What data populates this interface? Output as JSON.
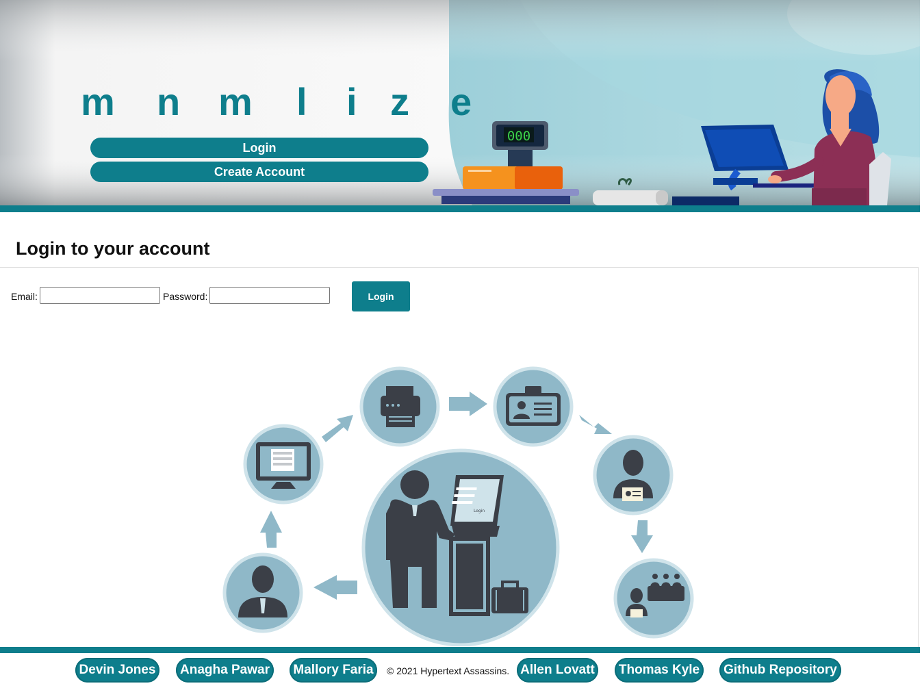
{
  "brand": {
    "letters": [
      "m",
      "n",
      "m",
      "l",
      "i",
      "z",
      "e"
    ]
  },
  "hero": {
    "login_label": "Login",
    "create_account_label": "Create Account",
    "scale_display": "000"
  },
  "login": {
    "heading": "Login to your account",
    "email_label": "Email:",
    "email_value": "",
    "password_label": "Password:",
    "password_value": "",
    "submit_label": "Login"
  },
  "diagram": {
    "screen_label": "Login"
  },
  "footer": {
    "links": [
      "Devin Jones",
      "Anagha Pawar",
      "Mallory Faria",
      "Allen Lovatt",
      "Thomas Kyle",
      "Github Repository"
    ],
    "copyright": "© 2021 Hypertext Assassins."
  },
  "colors": {
    "accent": "#0e7e8c",
    "diagram_circle": "#8fb8c8",
    "diagram_icon": "#3b3f47"
  }
}
